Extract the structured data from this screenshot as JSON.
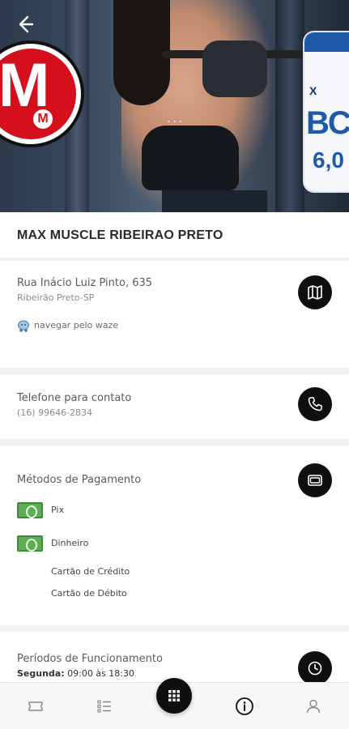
{
  "store": {
    "name": "MAX MUSCLE RIBEIRAO PRETO"
  },
  "hero": {
    "logo_letter": "M",
    "logo_mini": "M",
    "product_top": "X",
    "product_big": "BCA",
    "product_sub": "6,0"
  },
  "address": {
    "street": "Rua Inácio Luiz Pinto, 635",
    "city": "Ribeirão Preto-SP",
    "waze_link": "navegar pelo waze",
    "map_icon": "map-icon"
  },
  "contact": {
    "label": "Telefone para contato",
    "phone": "(16) 99646-2834",
    "phone_icon": "phone-icon"
  },
  "payment": {
    "label": "Métodos de Pagamento",
    "icon": "card-icon",
    "methods": [
      "Pix",
      "Dinheiro",
      "Cartão de Crédito",
      "Cartão de Débito"
    ]
  },
  "hours": {
    "label": "Períodos de Funcionamento",
    "first_day": "Segunda:",
    "first_time": "09:00 às 18:30",
    "icon": "clock-icon"
  },
  "nav": [
    "ticket-icon",
    "list-icon",
    "grid-icon",
    "info-icon",
    "user-icon"
  ]
}
